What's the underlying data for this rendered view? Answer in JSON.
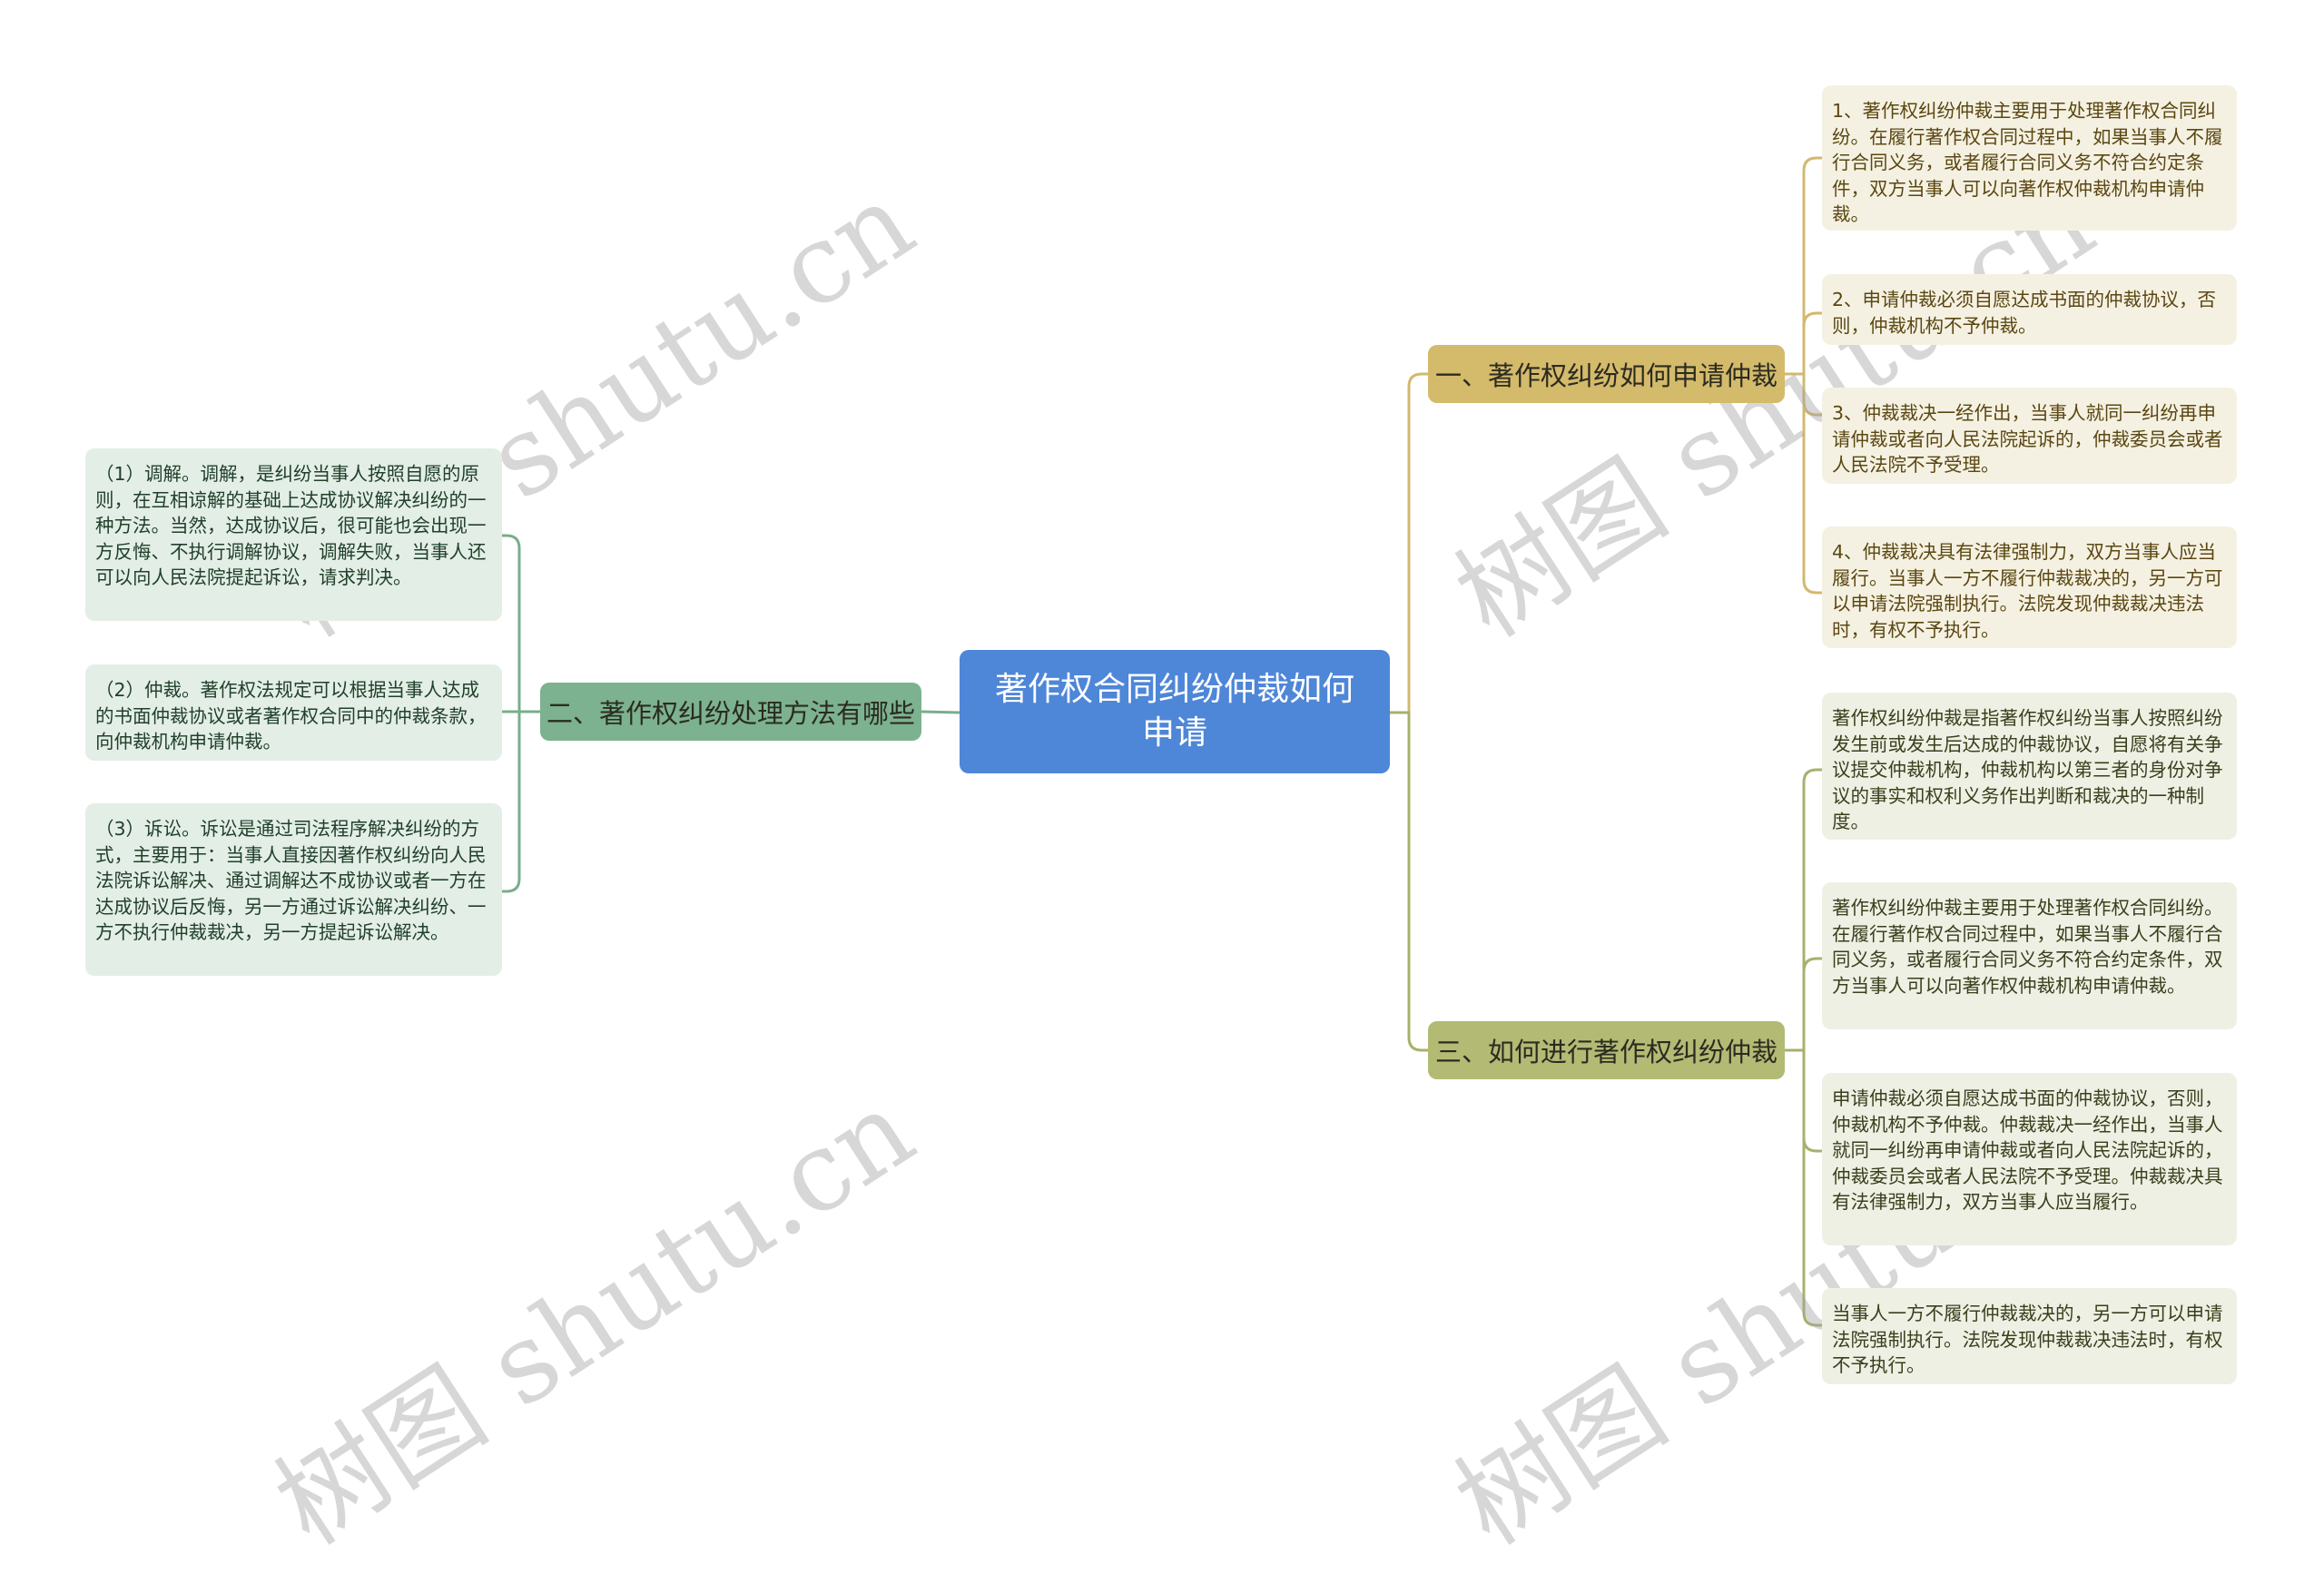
{
  "root": {
    "label": "著作权合同纠纷仲裁如何申请",
    "color": "#4e86d8"
  },
  "branches": [
    {
      "label": "一、著作权纠纷如何申请仲裁",
      "color": "#d4ba6b",
      "line_color": "#d2b96f",
      "side": "right",
      "children": [
        "1、著作权纠纷仲裁主要用于处理著作权合同纠纷。在履行著作权合同过程中，如果当事人不履行合同义务，或者履行合同义务不符合约定条件，双方当事人可以向著作权仲裁机构申请仲裁。",
        "2、申请仲裁必须自愿达成书面的仲裁协议，否则，仲裁机构不予仲裁。",
        "3、仲裁裁决一经作出，当事人就同一纠纷再申请仲裁或者向人民法院起诉的，仲裁委员会或者人民法院不予受理。",
        "4、仲裁裁决具有法律强制力，双方当事人应当履行。当事人一方不履行仲裁裁决的，另一方可以申请法院强制执行。法院发现仲裁裁决违法时，有权不予执行。"
      ]
    },
    {
      "label": "二、著作权纠纷处理方法有哪些",
      "color": "#7cb28f",
      "line_color": "#7aad8c",
      "side": "left",
      "children": [
        "（1）调解。调解，是纠纷当事人按照自愿的原则，在互相谅解的基础上达成协议解决纠纷的一种方法。当然，达成协议后，很可能也会出现一方反悔、不执行调解协议，调解失败，当事人还可以向人民法院提起诉讼，请求判决。",
        "（2）仲裁。著作权法规定可以根据当事人达成的书面仲裁协议或者著作权合同中的仲裁条款，向仲裁机构申请仲裁。",
        "（3）诉讼。诉讼是通过司法程序解决纠纷的方式，主要用于：当事人直接因著作权纠纷向人民法院诉讼解决、通过调解达不成协议或者一方在达成协议后反悔，另一方通过诉讼解决纠纷、一方不执行仲裁裁决，另一方提起诉讼解决。"
      ]
    },
    {
      "label": "三、如何进行著作权纠纷仲裁",
      "color": "#b3ba74",
      "line_color": "#a9b06c",
      "side": "right",
      "children": [
        "著作权纠纷仲裁是指著作权纠纷当事人按照纠纷发生前或发生后达成的仲裁协议，自愿将有关争议提交仲裁机构，仲裁机构以第三者的身份对争议的事实和权利义务作出判断和裁决的一种制度。",
        "著作权纠纷仲裁主要用于处理著作权合同纠纷。在履行著作权合同过程中，如果当事人不履行合同义务，或者履行合同义务不符合约定条件，双方当事人可以向著作权仲裁机构申请仲裁。",
        "申请仲裁必须自愿达成书面的仲裁协议，否则，仲裁机构不予仲裁。仲裁裁决一经作出，当事人就同一纠纷再申请仲裁或者向人民法院起诉的，仲裁委员会或者人民法院不予受理。仲裁裁决具有法律强制力，双方当事人应当履行。",
        "当事人一方不履行仲裁裁决的，另一方可以申请法院强制执行。法院发现仲裁裁决违法时，有权不予执行。"
      ]
    }
  ],
  "watermark": {
    "text": "树图 shutu.cn"
  }
}
